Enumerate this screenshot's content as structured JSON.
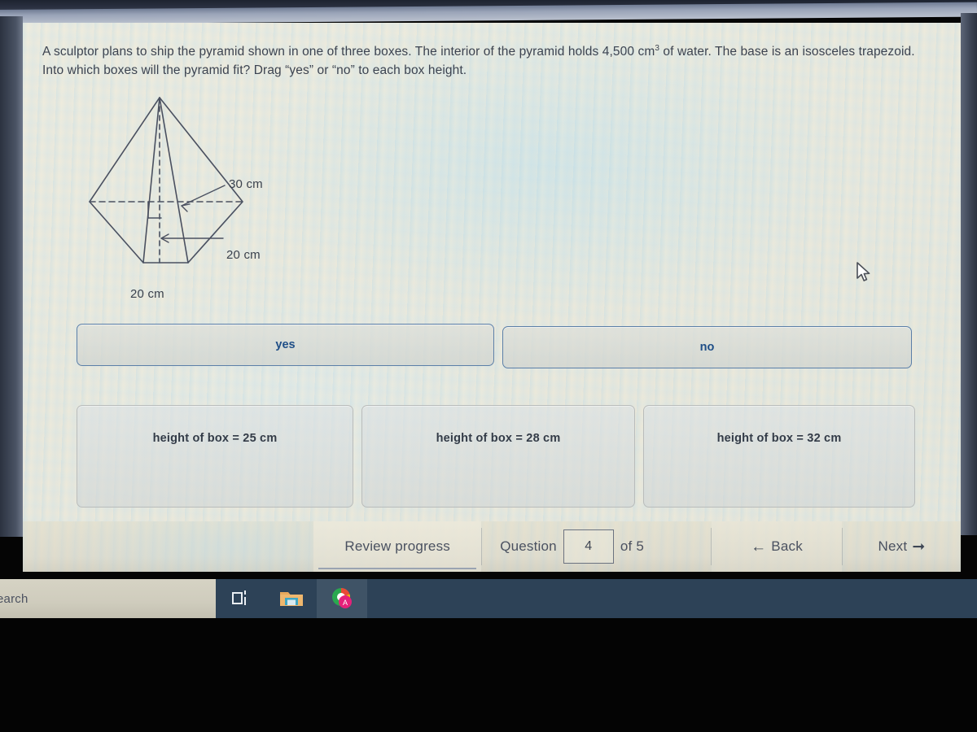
{
  "question": {
    "text_part1": "A sculptor plans to ship the pyramid shown in one of three boxes. The interior of the pyramid holds 4,500 cm",
    "exponent": "3",
    "text_part2": " of water. The base is an isosceles trapezoid. Into which boxes will the pyramid fit? Drag “yes” or “no” to each box height."
  },
  "figure": {
    "name": "pyramid-with-trapezoid-base",
    "slant_label": "30 cm",
    "depth_label": "20 cm",
    "base_label": "20 cm",
    "line_color": "#4a5060"
  },
  "chips": [
    {
      "id": "yes",
      "label": "yes"
    },
    {
      "id": "no",
      "label": "no"
    }
  ],
  "dropzones": [
    {
      "id": "box-25",
      "label": "height of box = 25 cm",
      "value": ""
    },
    {
      "id": "box-28",
      "label": "height of box = 28 cm",
      "value": ""
    },
    {
      "id": "box-32",
      "label": "height of box = 32 cm",
      "value": ""
    }
  ],
  "nav": {
    "review_label": "Review progress",
    "question_word": "Question",
    "question_number": "4",
    "of_label": "of 5",
    "back_label": "Back",
    "back_icon": "arrow-left-icon",
    "next_label": "Next",
    "next_icon": "arrow-right-icon"
  },
  "taskbar": {
    "search_placeholder": "earch",
    "taskview_icon": "task-view-icon",
    "explorer_icon": "file-explorer-icon",
    "browser_icon": "chrome-browser-icon"
  },
  "colors": {
    "chip_border": "#5b7fa8",
    "chip_text": "#1f4e87",
    "page_bg": "#e7e4d8",
    "taskbar_bg": "#2d4257",
    "text": "#3c4350"
  }
}
